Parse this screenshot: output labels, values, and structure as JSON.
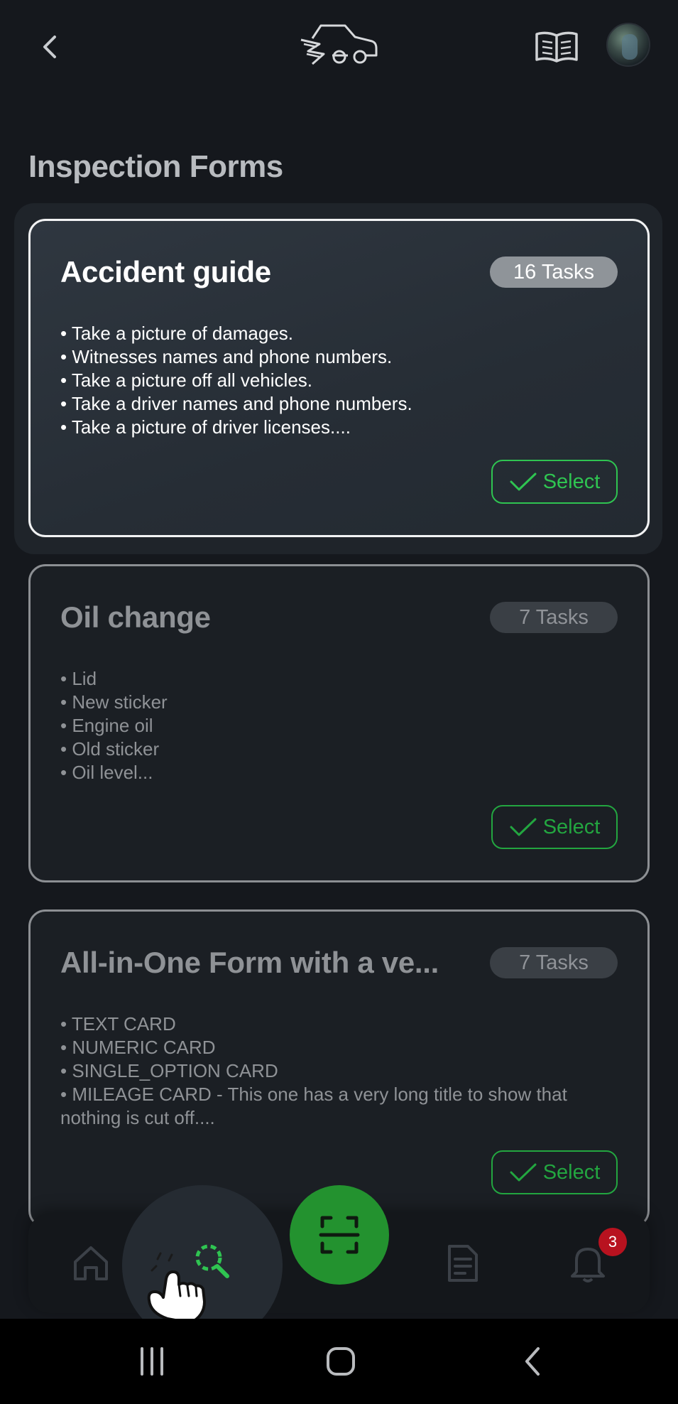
{
  "header": {
    "back_icon": "chevron-left-icon",
    "logo_icon": "truck-logo-icon",
    "book_icon": "book-open-icon",
    "avatar": "user-avatar"
  },
  "page": {
    "title": "Inspection Forms"
  },
  "forms": [
    {
      "title": "Accident guide",
      "tasks": "16 Tasks",
      "items": [
        "• Take a picture of damages.",
        "• Witnesses names and phone numbers.",
        "• Take a picture off all vehicles.",
        "• Take a driver names and phone numbers.",
        "• Take a picture of driver licenses...."
      ],
      "select_label": "Select",
      "active": true
    },
    {
      "title": "Oil change",
      "tasks": "7 Tasks",
      "items": [
        "• Lid",
        "• New sticker",
        "• Engine oil",
        "• Old sticker",
        "• Oil level..."
      ],
      "select_label": "Select",
      "active": false
    },
    {
      "title": "All-in-One Form with a ve...",
      "tasks": "7 Tasks",
      "items": [
        "• TEXT CARD",
        "• NUMERIC CARD",
        "• SINGLE_OPTION CARD",
        "• MILEAGE CARD - This one has a very long title to show that nothing is cut off...."
      ],
      "select_label": "Select",
      "active": false
    }
  ],
  "bottom_nav": {
    "items": [
      "home-icon",
      "search-icon",
      "scan-icon",
      "document-icon",
      "bell-icon"
    ],
    "active": "search-icon",
    "notification_count": "3"
  },
  "colors": {
    "accent_green": "#2fc451",
    "fab_green": "#23922f",
    "badge_red": "#b8121f",
    "background": "#15181d"
  }
}
